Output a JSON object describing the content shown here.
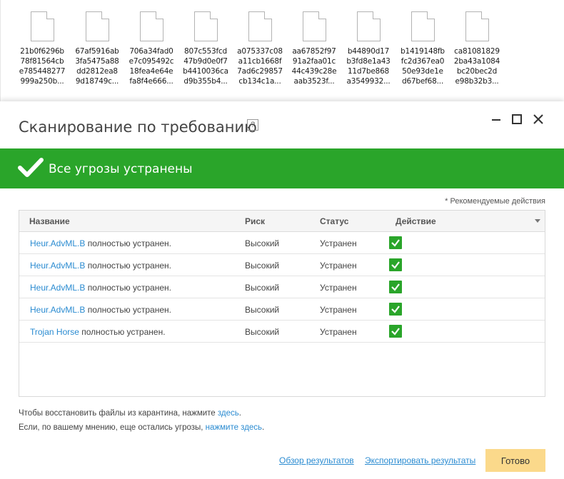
{
  "files": [
    {
      "lines": [
        "21b0f6296b",
        "78f81564cb",
        "e785448277",
        "999a250b..."
      ]
    },
    {
      "lines": [
        "67af5916ab",
        "3fa5475a88",
        "dd2812ea8",
        "9d18749c..."
      ]
    },
    {
      "lines": [
        "706a34fad0",
        "e7c095492c",
        "18fea4e64e",
        "fa8f4e666..."
      ]
    },
    {
      "lines": [
        "807c553fcd",
        "47b9d0e0f7",
        "b4410036ca",
        "d9b355b4..."
      ]
    },
    {
      "lines": [
        "a075337c08",
        "a11cb1668f",
        "7ad6c29857",
        "cb134c1a..."
      ]
    },
    {
      "lines": [
        "aa67852f97",
        "91a2faa01c",
        "44c439c28e",
        "aab3523f..."
      ]
    },
    {
      "lines": [
        "b44890d17",
        "b3fd8e1a43",
        "11d7be868",
        "a3549932..."
      ]
    },
    {
      "lines": [
        "b1419148fb",
        "fc2d367ea0",
        "50e93de1e",
        "d67bef68..."
      ]
    },
    {
      "lines": [
        "ca81081829",
        "2ba43a1084",
        "bc20bec2d",
        "e98b32b3..."
      ]
    }
  ],
  "dialog": {
    "title": "Сканирование по требованию",
    "help": "?",
    "banner": "Все угрозы устранены",
    "recommended": "* Рекомендуемые действия",
    "columns": {
      "name": "Название",
      "risk": "Риск",
      "status": "Статус",
      "action": "Действие"
    },
    "rows": [
      {
        "threat": "Heur.AdvML.B",
        "result": "полностью устранен.",
        "risk": "Высокий",
        "status": "Устранен"
      },
      {
        "threat": "Heur.AdvML.B",
        "result": "полностью устранен.",
        "risk": "Высокий",
        "status": "Устранен"
      },
      {
        "threat": "Heur.AdvML.B",
        "result": "полностью устранен.",
        "risk": "Высокий",
        "status": "Устранен"
      },
      {
        "threat": "Heur.AdvML.B",
        "result": "полностью устранен.",
        "risk": "Высокий",
        "status": "Устранен"
      },
      {
        "threat": "Trojan Horse",
        "result": "полностью устранен.",
        "risk": "Высокий",
        "status": "Устранен"
      }
    ],
    "note1_text": "Чтобы восстановить файлы из карантина, нажмите ",
    "note1_link": "здесь",
    "note1_end": ".",
    "note2_text": "Если, по вашему мнению, еще остались угрозы, ",
    "note2_link": "нажмите здесь",
    "note2_end": ".",
    "review_link": "Обзор результатов",
    "export_link": "Экспортировать результаты",
    "done_button": "Готово"
  },
  "colors": {
    "banner": "#2aa52a",
    "link": "#2a8bd1",
    "done_button": "#fbd98b"
  }
}
